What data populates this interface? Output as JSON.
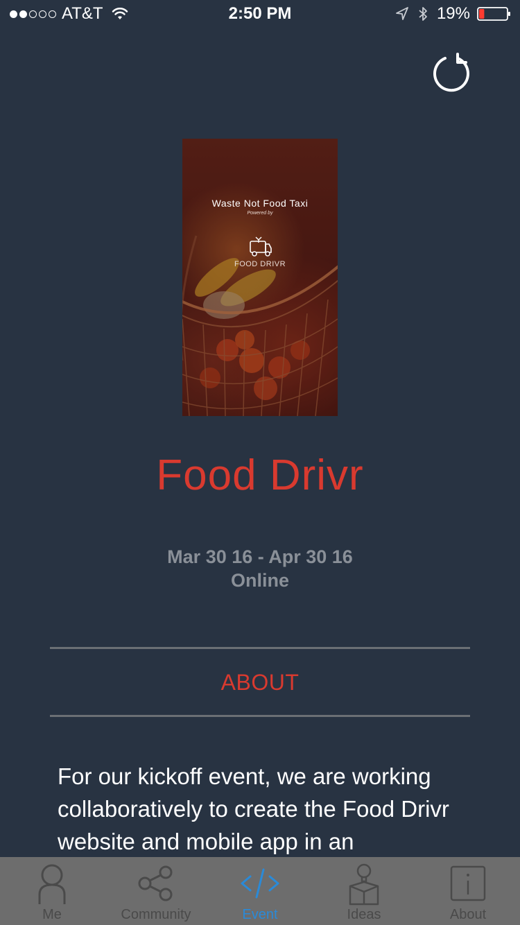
{
  "status_bar": {
    "carrier": "AT&T",
    "time": "2:50 PM",
    "battery_percent": "19%",
    "battery_level": 0.19,
    "signal_bars_filled": 2,
    "signal_bars_total": 5
  },
  "header": {
    "refresh_icon": "refresh-icon"
  },
  "poster": {
    "title": "Waste Not Food Taxi",
    "powered_by": "Powered by",
    "brand": "FOOD DRIVR"
  },
  "event": {
    "title": "Food Drivr",
    "dates": "Mar 30 16 - Apr 30 16",
    "location": "Online",
    "about_heading": "ABOUT",
    "about_text": "For our kickoff event, we are working collaboratively to create the Food Drivr website and mobile app in an"
  },
  "tabs": [
    {
      "label": "Me",
      "icon": "person-icon",
      "active": false
    },
    {
      "label": "Community",
      "icon": "share-icon",
      "active": false
    },
    {
      "label": "Event",
      "icon": "code-icon",
      "active": true
    },
    {
      "label": "Ideas",
      "icon": "lightbulb-box-icon",
      "active": false
    },
    {
      "label": "About",
      "icon": "info-icon",
      "active": false
    }
  ],
  "colors": {
    "background": "#283342",
    "accent_red": "#d93a2f",
    "tab_active": "#2a8ad8",
    "tab_bar": "#6d6d6d",
    "muted_text": "#8a9098"
  }
}
